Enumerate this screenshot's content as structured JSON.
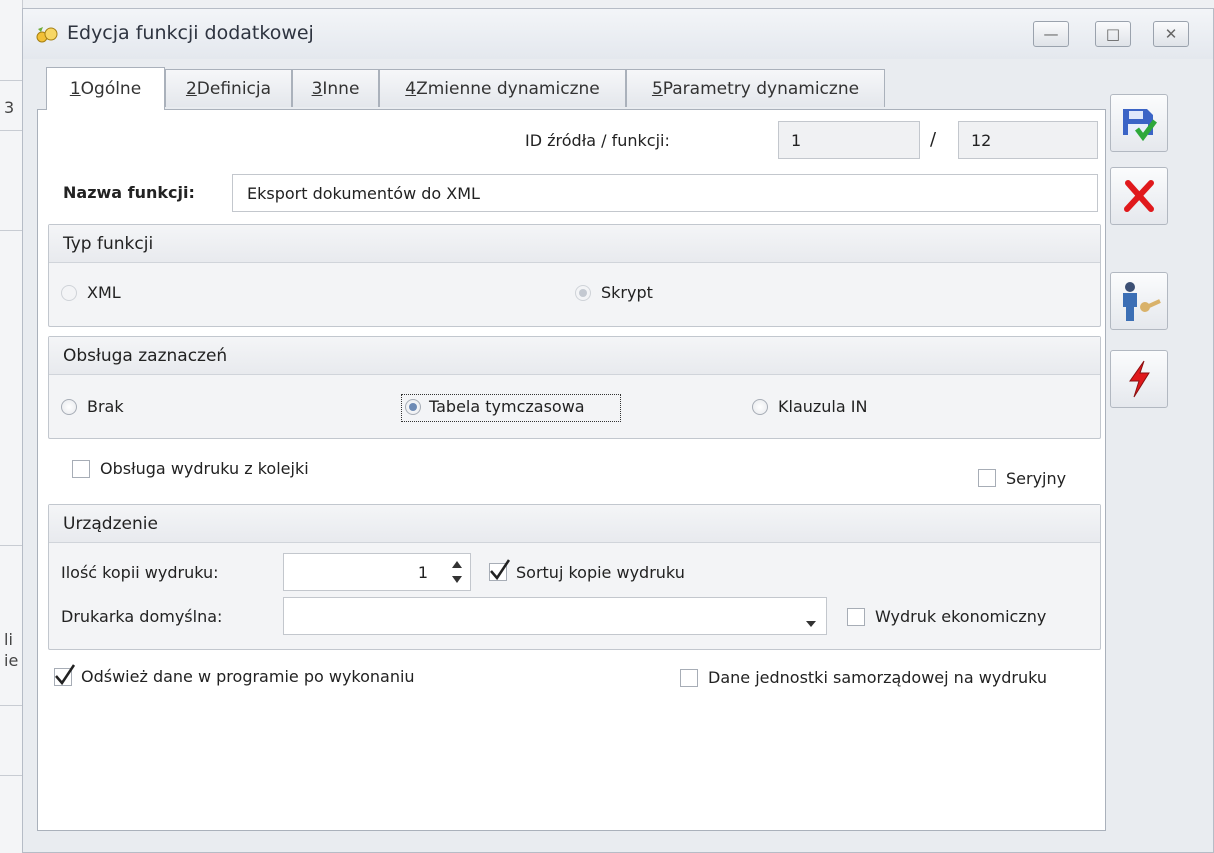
{
  "background": {
    "chars": [
      "3",
      "li",
      "ie"
    ]
  },
  "window": {
    "title": "Edycja funkcji dodatkowej",
    "minimize_glyph": "—",
    "maximize_glyph": "□",
    "close_glyph": "✕"
  },
  "tabs": [
    {
      "num": "1",
      "label": " Ogólne"
    },
    {
      "num": "2",
      "label": " Definicja"
    },
    {
      "num": "3",
      "label": " Inne"
    },
    {
      "num": "4",
      "label": " Zmienne dynamiczne"
    },
    {
      "num": "5",
      "label": " Parametry dynamiczne"
    }
  ],
  "general": {
    "id_label": "ID źródła / funkcji:",
    "id_source": "1",
    "id_separator": "/",
    "id_function": "12",
    "name_label": "Nazwa funkcji:",
    "name_value": "Eksport dokumentów do XML",
    "function_type": {
      "title": "Typ funkcji",
      "options": [
        "XML",
        "Skrypt"
      ],
      "selected": "Skrypt"
    },
    "selection_handling": {
      "title": "Obsługa zaznaczeń",
      "options": [
        "Brak",
        "Tabela tymczasowa",
        "Klauzula IN"
      ],
      "selected": "Tabela tymczasowa"
    },
    "print_queue_label": "Obsługa wydruku z kolejki",
    "serial_label": "Seryjny",
    "device": {
      "title": "Urządzenie",
      "copies_label": "Ilość kopii wydruku:",
      "copies_value": "1",
      "sort_copies_label": "Sortuj kopie wydruku",
      "printer_label": "Drukarka domyślna:",
      "printer_value": "",
      "economic_label": "Wydruk ekonomiczny"
    },
    "refresh_label": "Odśwież dane w programie po wykonaniu",
    "local_gov_label": "Dane jednostki samorządowej na wydruku"
  },
  "icons": {
    "save": "save-icon",
    "cancel": "cancel-icon",
    "permissions": "user-key-icon",
    "execute": "lightning-icon"
  },
  "colors": {
    "cancel_red": "#e0191c",
    "save_blue": "#3b64c6",
    "save_green": "#2fa83a"
  }
}
